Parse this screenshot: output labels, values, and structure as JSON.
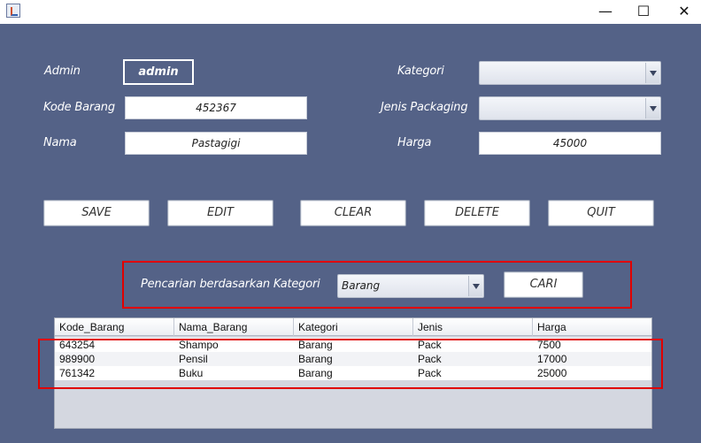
{
  "window": {
    "minimize": "—",
    "maximize": "☐",
    "close": "✕"
  },
  "form": {
    "admin_label": "Admin",
    "admin_value": "admin",
    "kode_label": "Kode Barang",
    "kode_value": "452367",
    "nama_label": "Nama",
    "nama_value": "Pastagigi",
    "kategori_label": "Kategori",
    "kategori_value": "",
    "jenis_label": "Jenis Packaging",
    "jenis_value": "",
    "harga_label": "Harga",
    "harga_value": "45000"
  },
  "buttons": {
    "save": "SAVE",
    "edit": "EDIT",
    "clear": "CLEAR",
    "delete": "DELETE",
    "quit": "QUIT"
  },
  "search": {
    "label": "Pencarian berdasarkan Kategori",
    "selected": "Barang",
    "button": "CARI"
  },
  "table": {
    "headers": [
      "Kode_Barang",
      "Nama_Barang",
      "Kategori",
      "Jenis",
      "Harga"
    ],
    "rows": [
      [
        "643254",
        "Shampo",
        "Barang",
        "Pack",
        "7500"
      ],
      [
        "989900",
        "Pensil",
        "Barang",
        "Pack",
        "17000"
      ],
      [
        "761342",
        "Buku",
        "Barang",
        "Pack",
        "25000"
      ]
    ]
  },
  "colors": {
    "background": "#546287",
    "highlight": "#e00000"
  }
}
